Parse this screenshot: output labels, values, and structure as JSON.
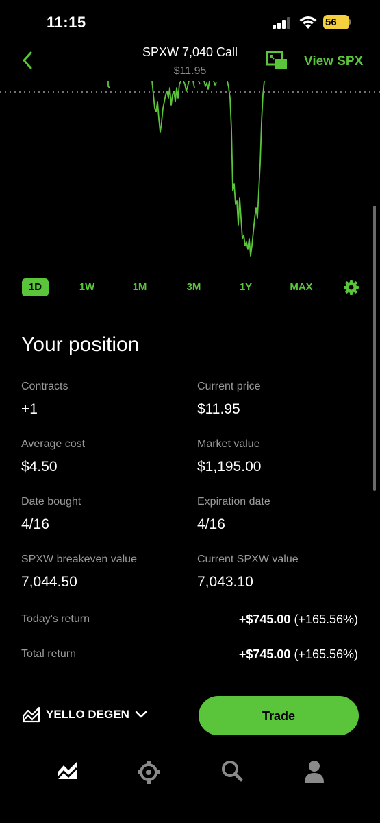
{
  "status_bar": {
    "time": "11:15",
    "battery": "56"
  },
  "header": {
    "title": "SPXW 7,040 Call",
    "price": "$11.95",
    "view_link": "View SPX"
  },
  "range_tabs": [
    "1D",
    "1W",
    "1M",
    "3M",
    "1Y",
    "MAX"
  ],
  "range_active": "1D",
  "position": {
    "title": "Your position",
    "fields": {
      "contracts": {
        "label": "Contracts",
        "value": "+1"
      },
      "current_price": {
        "label": "Current price",
        "value": "$11.95"
      },
      "average_cost": {
        "label": "Average cost",
        "value": "$4.50"
      },
      "market_value": {
        "label": "Market value",
        "value": "$1,195.00"
      },
      "date_bought": {
        "label": "Date bought",
        "value": "4/16"
      },
      "expiration_date": {
        "label": "Expiration date",
        "value": "4/16"
      },
      "breakeven": {
        "label": "SPXW breakeven value",
        "value": "7,044.50"
      },
      "current_spxw": {
        "label": "Current SPXW value",
        "value": "7,043.10"
      }
    },
    "todays_return": {
      "label": "Today's return",
      "amount": "+$745.00",
      "percent": "(+165.56%)"
    },
    "total_return": {
      "label": "Total return",
      "amount": "+$745.00",
      "percent": "(+165.56%)"
    }
  },
  "bottom": {
    "account_name": "YELLO DEGEN",
    "trade_label": "Trade"
  },
  "colors": {
    "accent": "#5ac53b",
    "background": "#000000",
    "muted": "#9a9a9a"
  },
  "icons": [
    "back-chevron-icon",
    "pip-icon",
    "gear-icon",
    "chart-icon",
    "chevron-down-icon",
    "browse-icon",
    "search-icon",
    "account-icon"
  ]
}
